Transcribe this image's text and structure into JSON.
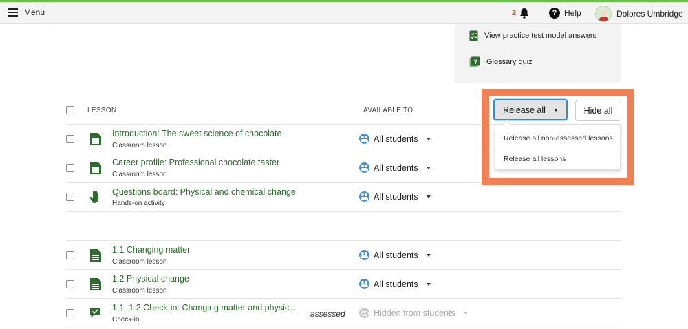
{
  "topbar": {
    "menu_label": "Menu",
    "notification_count": "2",
    "help_label": "Help",
    "user_name": "Dolores Umbridge",
    "accent_color": "#6bc04b"
  },
  "resources": [
    {
      "icon": "checklist-icon",
      "label": "View practice test model answers"
    },
    {
      "icon": "question-book-icon",
      "label": "Glossary quiz"
    }
  ],
  "table": {
    "col_lesson": "LESSON",
    "col_available": "AVAILABLE TO"
  },
  "actions": {
    "release_all": "Release all",
    "hide_all": "Hide all",
    "dropdown": [
      "Release all non-assessed lessons",
      "Release all lessons"
    ],
    "highlight_color": "#ef8157"
  },
  "lessons": [
    {
      "title": "Introduction: The sweet science of chocolate",
      "type": "Classroom lesson",
      "icon": "document-icon",
      "available": "All students"
    },
    {
      "title": "Career profile: Professional chocolate taster",
      "type": "Classroom lesson",
      "icon": "document-icon",
      "available": "All students"
    },
    {
      "title": "Questions board: Physical and chemical change",
      "type": "Hands-on activity",
      "icon": "hand-icon",
      "available": "All students"
    },
    {
      "title": "1.1 Changing matter",
      "type": "Classroom lesson",
      "icon": "document-icon",
      "available": "All students"
    },
    {
      "title": "1.2 Physical change",
      "type": "Classroom lesson",
      "icon": "document-icon",
      "available": "All students"
    },
    {
      "title": "1.1–1.2 Check-in: Changing matter and physic...",
      "type": "Check-in",
      "icon": "check-in-icon",
      "available": "Hidden from students",
      "badge": "assessed"
    }
  ]
}
